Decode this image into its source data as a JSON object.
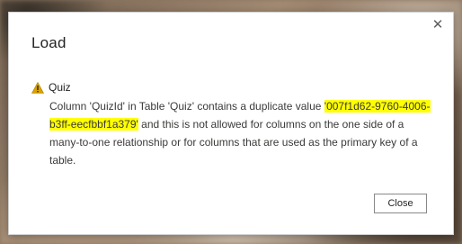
{
  "dialog": {
    "title": "Load",
    "close_glyph": "✕",
    "close_button_label": "Close"
  },
  "message": {
    "icon": "warning-icon",
    "table_name": "Quiz",
    "text_before": "Column 'QuizId' in Table 'Quiz' contains a duplicate value ",
    "duplicate_value": "'007f1d62-9760-4006-b3ff-eecfbbf1a379'",
    "text_after": " and this is not allowed for columns on the one side of a many-to-one relationship or for columns that are used as the primary key of a table.",
    "highlight_color": "#ffff00"
  },
  "colors": {
    "warning_fill": "#d8a200",
    "text": "#252423"
  }
}
